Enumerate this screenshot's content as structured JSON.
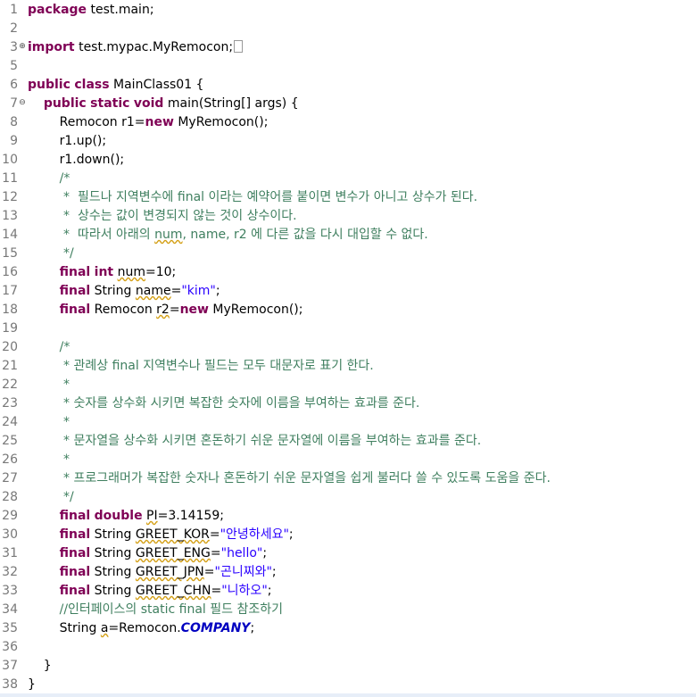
{
  "editor": {
    "lines": [
      {
        "n": "1",
        "m": "",
        "t": [
          {
            "c": "kw",
            "v": "package"
          },
          {
            "v": " test.main;"
          }
        ]
      },
      {
        "n": "2",
        "m": "",
        "t": []
      },
      {
        "n": "3",
        "m": "⊕",
        "t": [
          {
            "c": "kw",
            "v": "import"
          },
          {
            "v": " test.mypac.MyRemocon;"
          },
          {
            "c": "box",
            "v": ""
          }
        ]
      },
      {
        "n": "5",
        "m": "",
        "t": []
      },
      {
        "n": "6",
        "m": "",
        "t": [
          {
            "c": "kw",
            "v": "public"
          },
          {
            "v": " "
          },
          {
            "c": "kw",
            "v": "class"
          },
          {
            "v": " MainClass01 {"
          }
        ]
      },
      {
        "n": "7",
        "m": "⊖",
        "t": [
          {
            "v": "    "
          },
          {
            "c": "kw",
            "v": "public"
          },
          {
            "v": " "
          },
          {
            "c": "kw",
            "v": "static"
          },
          {
            "v": " "
          },
          {
            "c": "kw",
            "v": "void"
          },
          {
            "v": " main(String[] args) {"
          }
        ]
      },
      {
        "n": "8",
        "m": "",
        "t": [
          {
            "v": "        Remocon r1="
          },
          {
            "c": "kw",
            "v": "new"
          },
          {
            "v": " MyRemocon();"
          }
        ]
      },
      {
        "n": "9",
        "m": "",
        "t": [
          {
            "v": "        r1.up();"
          }
        ]
      },
      {
        "n": "10",
        "m": "",
        "t": [
          {
            "v": "        r1.down();"
          }
        ]
      },
      {
        "n": "11",
        "m": "",
        "t": [
          {
            "c": "cm",
            "v": "        /*"
          }
        ]
      },
      {
        "n": "12",
        "m": "",
        "t": [
          {
            "c": "cm",
            "v": "         *  필드나 지역변수에 final 이라는 예약어를 붙이면 변수가 아니고 상수가 된다."
          }
        ]
      },
      {
        "n": "13",
        "m": "",
        "t": [
          {
            "c": "cm",
            "v": "         *  상수는 값이 변경되지 않는 것이 상수이다."
          }
        ]
      },
      {
        "n": "14",
        "m": "",
        "t": [
          {
            "c": "cm",
            "v": "         *  따라서 아래의 "
          },
          {
            "c": "cm warn",
            "v": "num"
          },
          {
            "c": "cm",
            "v": ", name, r2 에 다른 값을 다시 대입할 수 없다."
          }
        ]
      },
      {
        "n": "15",
        "m": "",
        "t": [
          {
            "c": "cm",
            "v": "         */"
          }
        ]
      },
      {
        "n": "16",
        "m": "",
        "t": [
          {
            "v": "        "
          },
          {
            "c": "kw",
            "v": "final"
          },
          {
            "v": " "
          },
          {
            "c": "kw",
            "v": "int"
          },
          {
            "v": " "
          },
          {
            "c": "warn",
            "v": "num"
          },
          {
            "v": "=10;"
          }
        ]
      },
      {
        "n": "17",
        "m": "",
        "t": [
          {
            "v": "        "
          },
          {
            "c": "kw",
            "v": "final"
          },
          {
            "v": " String "
          },
          {
            "c": "warn",
            "v": "name"
          },
          {
            "v": "="
          },
          {
            "c": "str",
            "v": "\"kim\""
          },
          {
            "v": ";"
          }
        ]
      },
      {
        "n": "18",
        "m": "",
        "t": [
          {
            "v": "        "
          },
          {
            "c": "kw",
            "v": "final"
          },
          {
            "v": " Remocon "
          },
          {
            "c": "warn",
            "v": "r2"
          },
          {
            "v": "="
          },
          {
            "c": "kw",
            "v": "new"
          },
          {
            "v": " MyRemocon();"
          }
        ]
      },
      {
        "n": "19",
        "m": "",
        "t": []
      },
      {
        "n": "20",
        "m": "",
        "t": [
          {
            "c": "cm",
            "v": "        /*"
          }
        ]
      },
      {
        "n": "21",
        "m": "",
        "t": [
          {
            "c": "cm",
            "v": "         * 관례상 final 지역변수나 필드는 모두 대문자로 표기 한다."
          }
        ]
      },
      {
        "n": "22",
        "m": "",
        "t": [
          {
            "c": "cm",
            "v": "         *"
          }
        ]
      },
      {
        "n": "23",
        "m": "",
        "t": [
          {
            "c": "cm",
            "v": "         * 숫자를 상수화 시키면 복잡한 숫자에 이름을 부여하는 효과를 준다."
          }
        ]
      },
      {
        "n": "24",
        "m": "",
        "t": [
          {
            "c": "cm",
            "v": "         *"
          }
        ]
      },
      {
        "n": "25",
        "m": "",
        "t": [
          {
            "c": "cm",
            "v": "         * 문자열을 상수화 시키면 혼돈하기 쉬운 문자열에 이름을 부여하는 효과를 준다."
          }
        ]
      },
      {
        "n": "26",
        "m": "",
        "t": [
          {
            "c": "cm",
            "v": "         *"
          }
        ]
      },
      {
        "n": "27",
        "m": "",
        "t": [
          {
            "c": "cm",
            "v": "         * 프로그래머가 복잡한 숫자나 혼돈하기 쉬운 문자열을 쉽게 불러다 쓸 수 있도록 도움을 준다."
          }
        ]
      },
      {
        "n": "28",
        "m": "",
        "t": [
          {
            "c": "cm",
            "v": "         */"
          }
        ]
      },
      {
        "n": "29",
        "m": "",
        "t": [
          {
            "v": "        "
          },
          {
            "c": "kw",
            "v": "final"
          },
          {
            "v": " "
          },
          {
            "c": "kw",
            "v": "double"
          },
          {
            "v": " "
          },
          {
            "c": "warn",
            "v": "PI"
          },
          {
            "v": "=3.14159;"
          }
        ]
      },
      {
        "n": "30",
        "m": "",
        "t": [
          {
            "v": "        "
          },
          {
            "c": "kw",
            "v": "final"
          },
          {
            "v": " String "
          },
          {
            "c": "warn",
            "v": "GREET_KOR"
          },
          {
            "v": "="
          },
          {
            "c": "str",
            "v": "\"안녕하세요\""
          },
          {
            "v": ";"
          }
        ]
      },
      {
        "n": "31",
        "m": "",
        "t": [
          {
            "v": "        "
          },
          {
            "c": "kw",
            "v": "final"
          },
          {
            "v": " String "
          },
          {
            "c": "warn",
            "v": "GREET_ENG"
          },
          {
            "v": "="
          },
          {
            "c": "str",
            "v": "\"hello\""
          },
          {
            "v": ";"
          }
        ]
      },
      {
        "n": "32",
        "m": "",
        "t": [
          {
            "v": "        "
          },
          {
            "c": "kw",
            "v": "final"
          },
          {
            "v": " String "
          },
          {
            "c": "warn",
            "v": "GREET_JPN"
          },
          {
            "v": "="
          },
          {
            "c": "str",
            "v": "\"곤니찌와\""
          },
          {
            "v": ";"
          }
        ]
      },
      {
        "n": "33",
        "m": "",
        "t": [
          {
            "v": "        "
          },
          {
            "c": "kw",
            "v": "final"
          },
          {
            "v": " String "
          },
          {
            "c": "warn",
            "v": "GREET_CHN"
          },
          {
            "v": "="
          },
          {
            "c": "str",
            "v": "\"니하오\""
          },
          {
            "v": ";"
          }
        ]
      },
      {
        "n": "34",
        "m": "",
        "t": [
          {
            "c": "cm",
            "v": "        //인터페이스의 static final 필드 참조하기"
          }
        ]
      },
      {
        "n": "35",
        "m": "",
        "t": [
          {
            "v": "        String "
          },
          {
            "c": "warn",
            "v": "a"
          },
          {
            "v": "=Remocon."
          },
          {
            "c": "sf",
            "v": "COMPANY"
          },
          {
            "v": ";"
          }
        ]
      },
      {
        "n": "36",
        "m": "",
        "t": []
      },
      {
        "n": "37",
        "m": "",
        "t": [
          {
            "v": "    }"
          }
        ]
      },
      {
        "n": "38",
        "m": "",
        "t": [
          {
            "v": "}"
          }
        ]
      }
    ]
  }
}
